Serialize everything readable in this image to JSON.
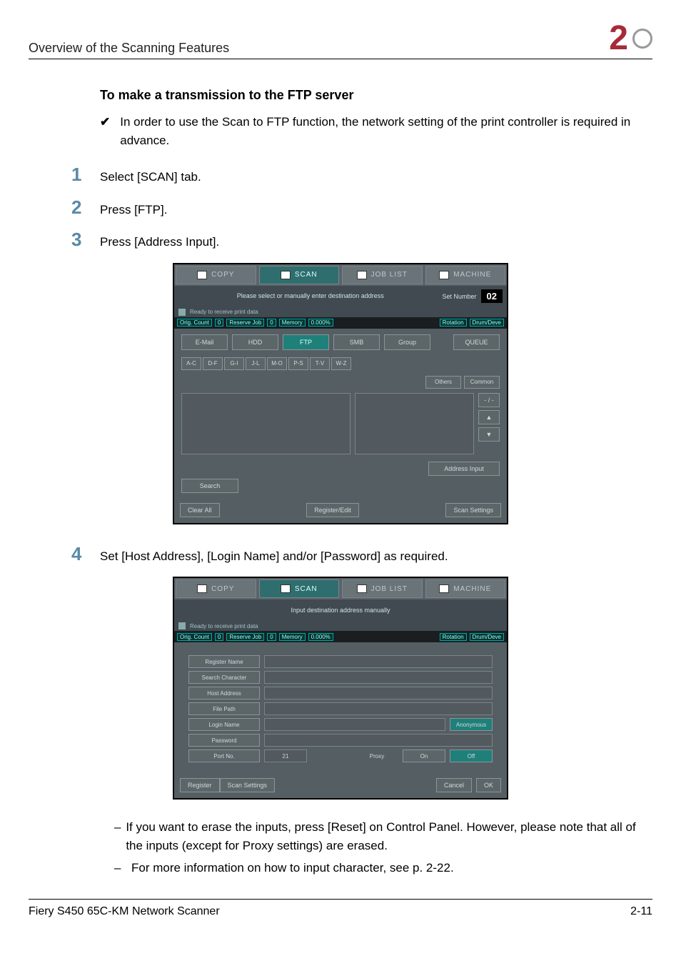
{
  "header": {
    "title": "Overview of the Scanning Features",
    "chapter": "2"
  },
  "h3": "To make a transmission to the FTP server",
  "bullet": "In order to use the Scan to FTP function, the network setting of the print controller is required in advance.",
  "steps": {
    "s1": {
      "num": "1",
      "text": "Select [SCAN] tab."
    },
    "s2": {
      "num": "2",
      "text": "Press [FTP]."
    },
    "s3": {
      "num": "3",
      "text": "Press [Address Input]."
    },
    "s4": {
      "num": "4",
      "text": "Set [Host Address], [Login Name] and/or [Password] as required."
    }
  },
  "notes": {
    "n1": "If you want to erase the inputs, press [Reset] on Control Panel. However, please note that all of the inputs (except for Proxy settings) are erased.",
    "n2": "For more information on how to input character, see p. 2-22."
  },
  "fig1": {
    "tabs": {
      "copy": "COPY",
      "scan": "SCAN",
      "joblist": "JOB LIST",
      "machine": "MACHINE"
    },
    "msg": "Please select or manually enter destination address",
    "setnum_label": "Set Number",
    "setnum_val": "02",
    "ready": "Ready to receive print data",
    "status": {
      "orig": "Orig. Count",
      "orig_v": "0",
      "res": "Reserve Job",
      "res_v": "0",
      "mem": "Memory",
      "mem_v": "0.000%",
      "rot": "Rotation",
      "drum": "Drum/Deve"
    },
    "modes": {
      "email": "E-Mail",
      "hdd": "HDD",
      "ftp": "FTP",
      "smb": "SMB",
      "group": "Group",
      "queue": "QUEUE"
    },
    "alpha": [
      "A-C",
      "D-F",
      "G-I",
      "J-L",
      "M-O",
      "P-S",
      "T-V",
      "W-Z"
    ],
    "others": "Others",
    "common": "Common",
    "pager": "- / -",
    "addr_input": "Address Input",
    "search": "Search",
    "clear": "Clear All",
    "regedit": "Register/Edit",
    "scanset": "Scan Settings"
  },
  "fig2": {
    "tabs": {
      "copy": "COPY",
      "scan": "SCAN",
      "joblist": "JOB LIST",
      "machine": "MACHINE"
    },
    "msg": "Input destination address manually",
    "ready": "Ready to receive print data",
    "status": {
      "orig": "Orig. Count",
      "orig_v": "0",
      "res": "Reserve Job",
      "res_v": "0",
      "mem": "Memory",
      "mem_v": "0.000%",
      "rot": "Rotation",
      "drum": "Drum/Deve"
    },
    "labels": {
      "regname": "Register Name",
      "searchchar": "Search Character",
      "host": "Host Address",
      "filepath": "File Path",
      "login": "Login Name",
      "password": "Password",
      "port": "Port No."
    },
    "anon": "Anonymous",
    "portval": "21",
    "proxy": "Proxy",
    "on": "On",
    "off": "Off",
    "register": "Register",
    "scanset": "Scan Settings",
    "cancel": "Cancel",
    "ok": "OK"
  },
  "footer": {
    "left": "Fiery S450 65C-KM Network Scanner",
    "right": "2-11"
  }
}
